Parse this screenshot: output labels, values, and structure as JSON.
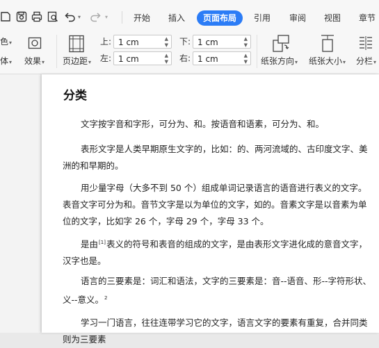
{
  "ribbon_tabs": {
    "start": "开始",
    "insert": "插入",
    "page_layout": "页面布局",
    "references": "引用",
    "review": "审阅",
    "view": "视图",
    "sections": "章节"
  },
  "ribbon": {
    "color_label": "颜色",
    "font_label": "字体",
    "effects_label": "效果",
    "margins_label": "页边距",
    "top_label": "上:",
    "bottom_label": "下:",
    "left_label": "左:",
    "right_label": "右:",
    "top_value": "1 cm",
    "bottom_value": "1 cm",
    "left_value": "1 cm",
    "right_value": "1 cm",
    "orientation_label": "纸张方向",
    "size_label": "纸张大小",
    "columns_label": "分栏"
  },
  "document": {
    "title": "分类",
    "p1": "文字按字音和字形，可分为、和。按语音和语素，可分为、和。",
    "p2": "表形文字是人类早期原生文字的，比如：的、两河流域的、古印度文字、美洲的和早期的。",
    "p3": "用少量字母（大多不到 50 个）组成单词记录语言的语音进行表义的文字。表音文字可分为和。音节文字是以为单位的文字，如的。音素文字是以音素为单位的文字，比如字 26 个，字母 29 个，字母 33 个。",
    "p4_a": "是由",
    "p4_sup": "[1]",
    "p4_b": "表义的符号和表音的组成的文字，是由表形文字进化成的意音文字，汉字也是。",
    "p5": "语言的三要素是：词汇和语法，文字的三要素是：音--语音、形--字符形状、义--意义。",
    "p5_sup": "2",
    "p6": "学习一门语言，往往连带学习它的文字，语言文字的要素有重复，合并同类则为三要素"
  },
  "colors": {
    "accent": "#2b7cf6",
    "toolbar_bg": "#f7f7f7",
    "page_bg": "#ffffff",
    "canvas_bg": "#f3f3f3"
  }
}
